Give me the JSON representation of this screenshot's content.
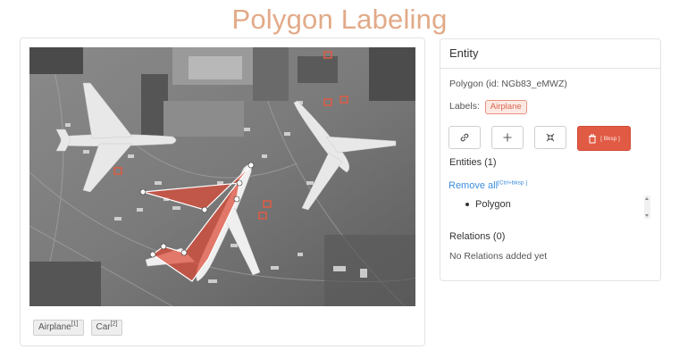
{
  "page": {
    "title": "Polygon Labeling"
  },
  "labels_bar": {
    "chips": [
      {
        "label": "Airplane",
        "hotkey": "[1]"
      },
      {
        "label": "Car",
        "hotkey": "[2]"
      }
    ]
  },
  "entity_panel": {
    "header": "Entity",
    "entity_id_text": "Polygon (id: NGb83_eMWZ)",
    "labels_prefix": "Labels:",
    "label_tag": "Airplane",
    "buttons": {
      "link_icon": "link-icon",
      "add_icon": "plus-icon",
      "collapse_icon": "collapse-arrows-icon",
      "delete_icon": "trash-icon",
      "delete_hotkey": "[ Bksp ]"
    },
    "entities_title": "Entities (1)",
    "remove_all_label": "Remove all",
    "remove_all_hotkey": "[Ctrl+bksp ]",
    "entities": [
      "Polygon"
    ],
    "relations_title": "Relations (0)",
    "no_relations_text": "No Relations added yet"
  },
  "colors": {
    "title": "#e2aa88",
    "polygon_fill": "#dd4a36",
    "polygon_stroke": "#ffffff",
    "delete_button": "#e05a44",
    "link": "#3c8dde",
    "label_tag_border": "#e6927f"
  }
}
